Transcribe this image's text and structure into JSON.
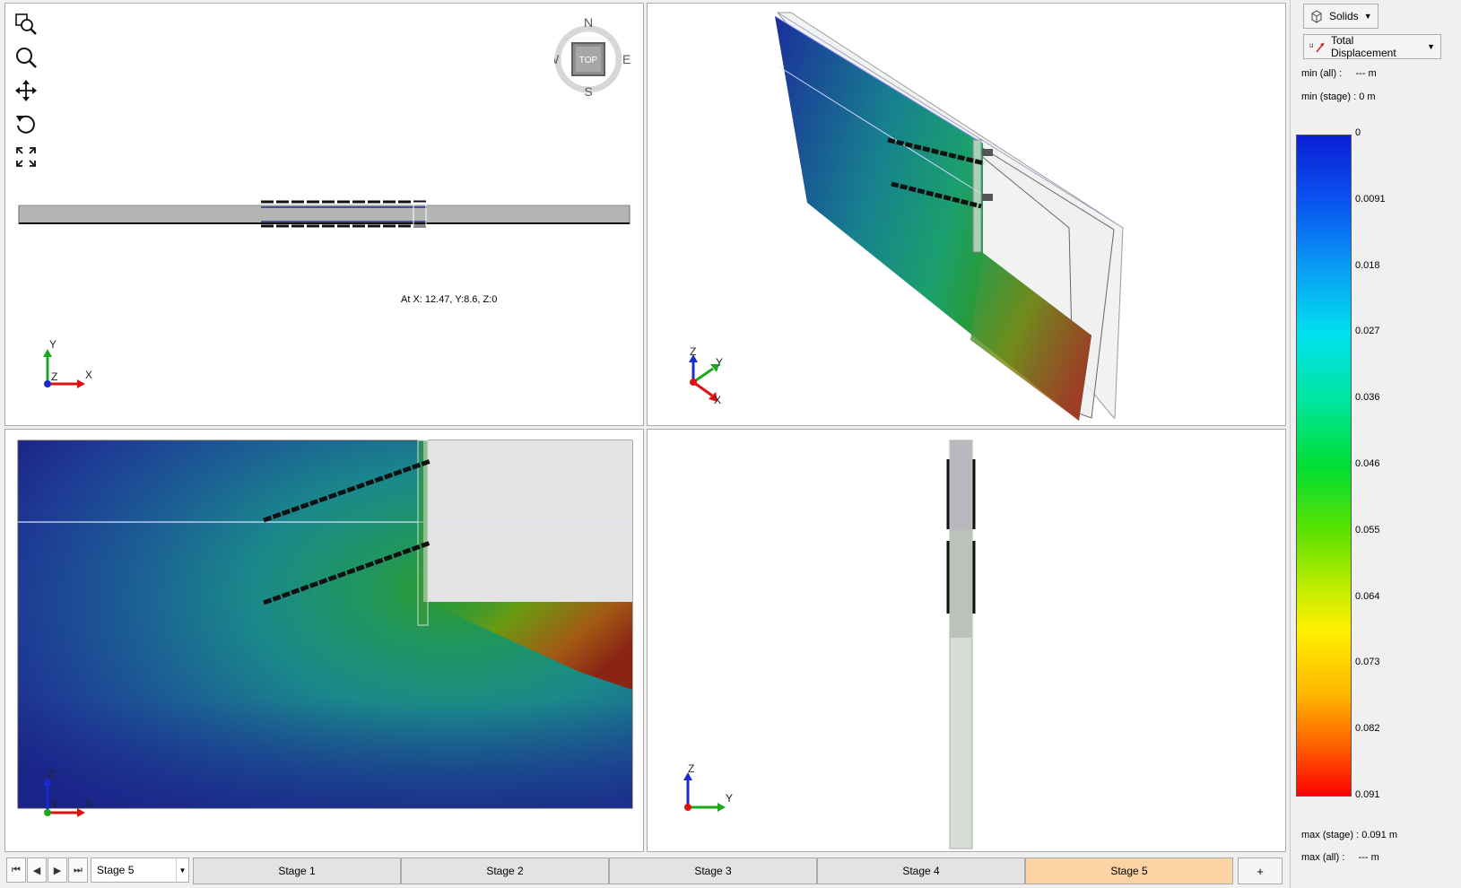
{
  "compass": {
    "north": "N",
    "south": "S",
    "east": "E",
    "west": "W",
    "face": "TOP"
  },
  "viewports": {
    "top": {
      "readout": "At X: 12.47, Y:8.6, Z:0",
      "triad": {
        "up": "Y",
        "right": "X",
        "depth": "Z"
      }
    },
    "iso": {
      "triad": {
        "up": "Z",
        "diag": "Y",
        "right": "X"
      }
    },
    "front": {
      "triad": {
        "up": "Z",
        "right": "X",
        "depth": "Y"
      }
    },
    "side": {
      "triad": {
        "up": "Z",
        "right": "Y"
      }
    }
  },
  "toolbar": {
    "tools": [
      "zoom-window-icon",
      "zoom-icon",
      "pan-icon",
      "rotate-icon",
      "fit-extents-icon"
    ]
  },
  "legend": {
    "entity_dropdown": "Solids",
    "result_dropdown": "Total Displacement",
    "min_all_label": "min (all) :",
    "min_all_value": "--- m",
    "min_stage_label": "min (stage) :",
    "min_stage_value": "0 m",
    "max_stage_label": "max (stage) :",
    "max_stage_value": "0.091 m",
    "max_all_label": "max (all) :",
    "max_all_value": "--- m",
    "ticks": [
      "0",
      "0.0091",
      "0.018",
      "0.027",
      "0.036",
      "0.046",
      "0.055",
      "0.064",
      "0.073",
      "0.082",
      "0.091"
    ],
    "colors": {
      "min": "#0a1fd6",
      "max": "#ff0000"
    }
  },
  "stagebar": {
    "current": "Stage 5",
    "tabs": [
      "Stage 1",
      "Stage 2",
      "Stage 3",
      "Stage 4",
      "Stage 5"
    ],
    "add_label": "+",
    "active_color": "#fcd3a3"
  }
}
